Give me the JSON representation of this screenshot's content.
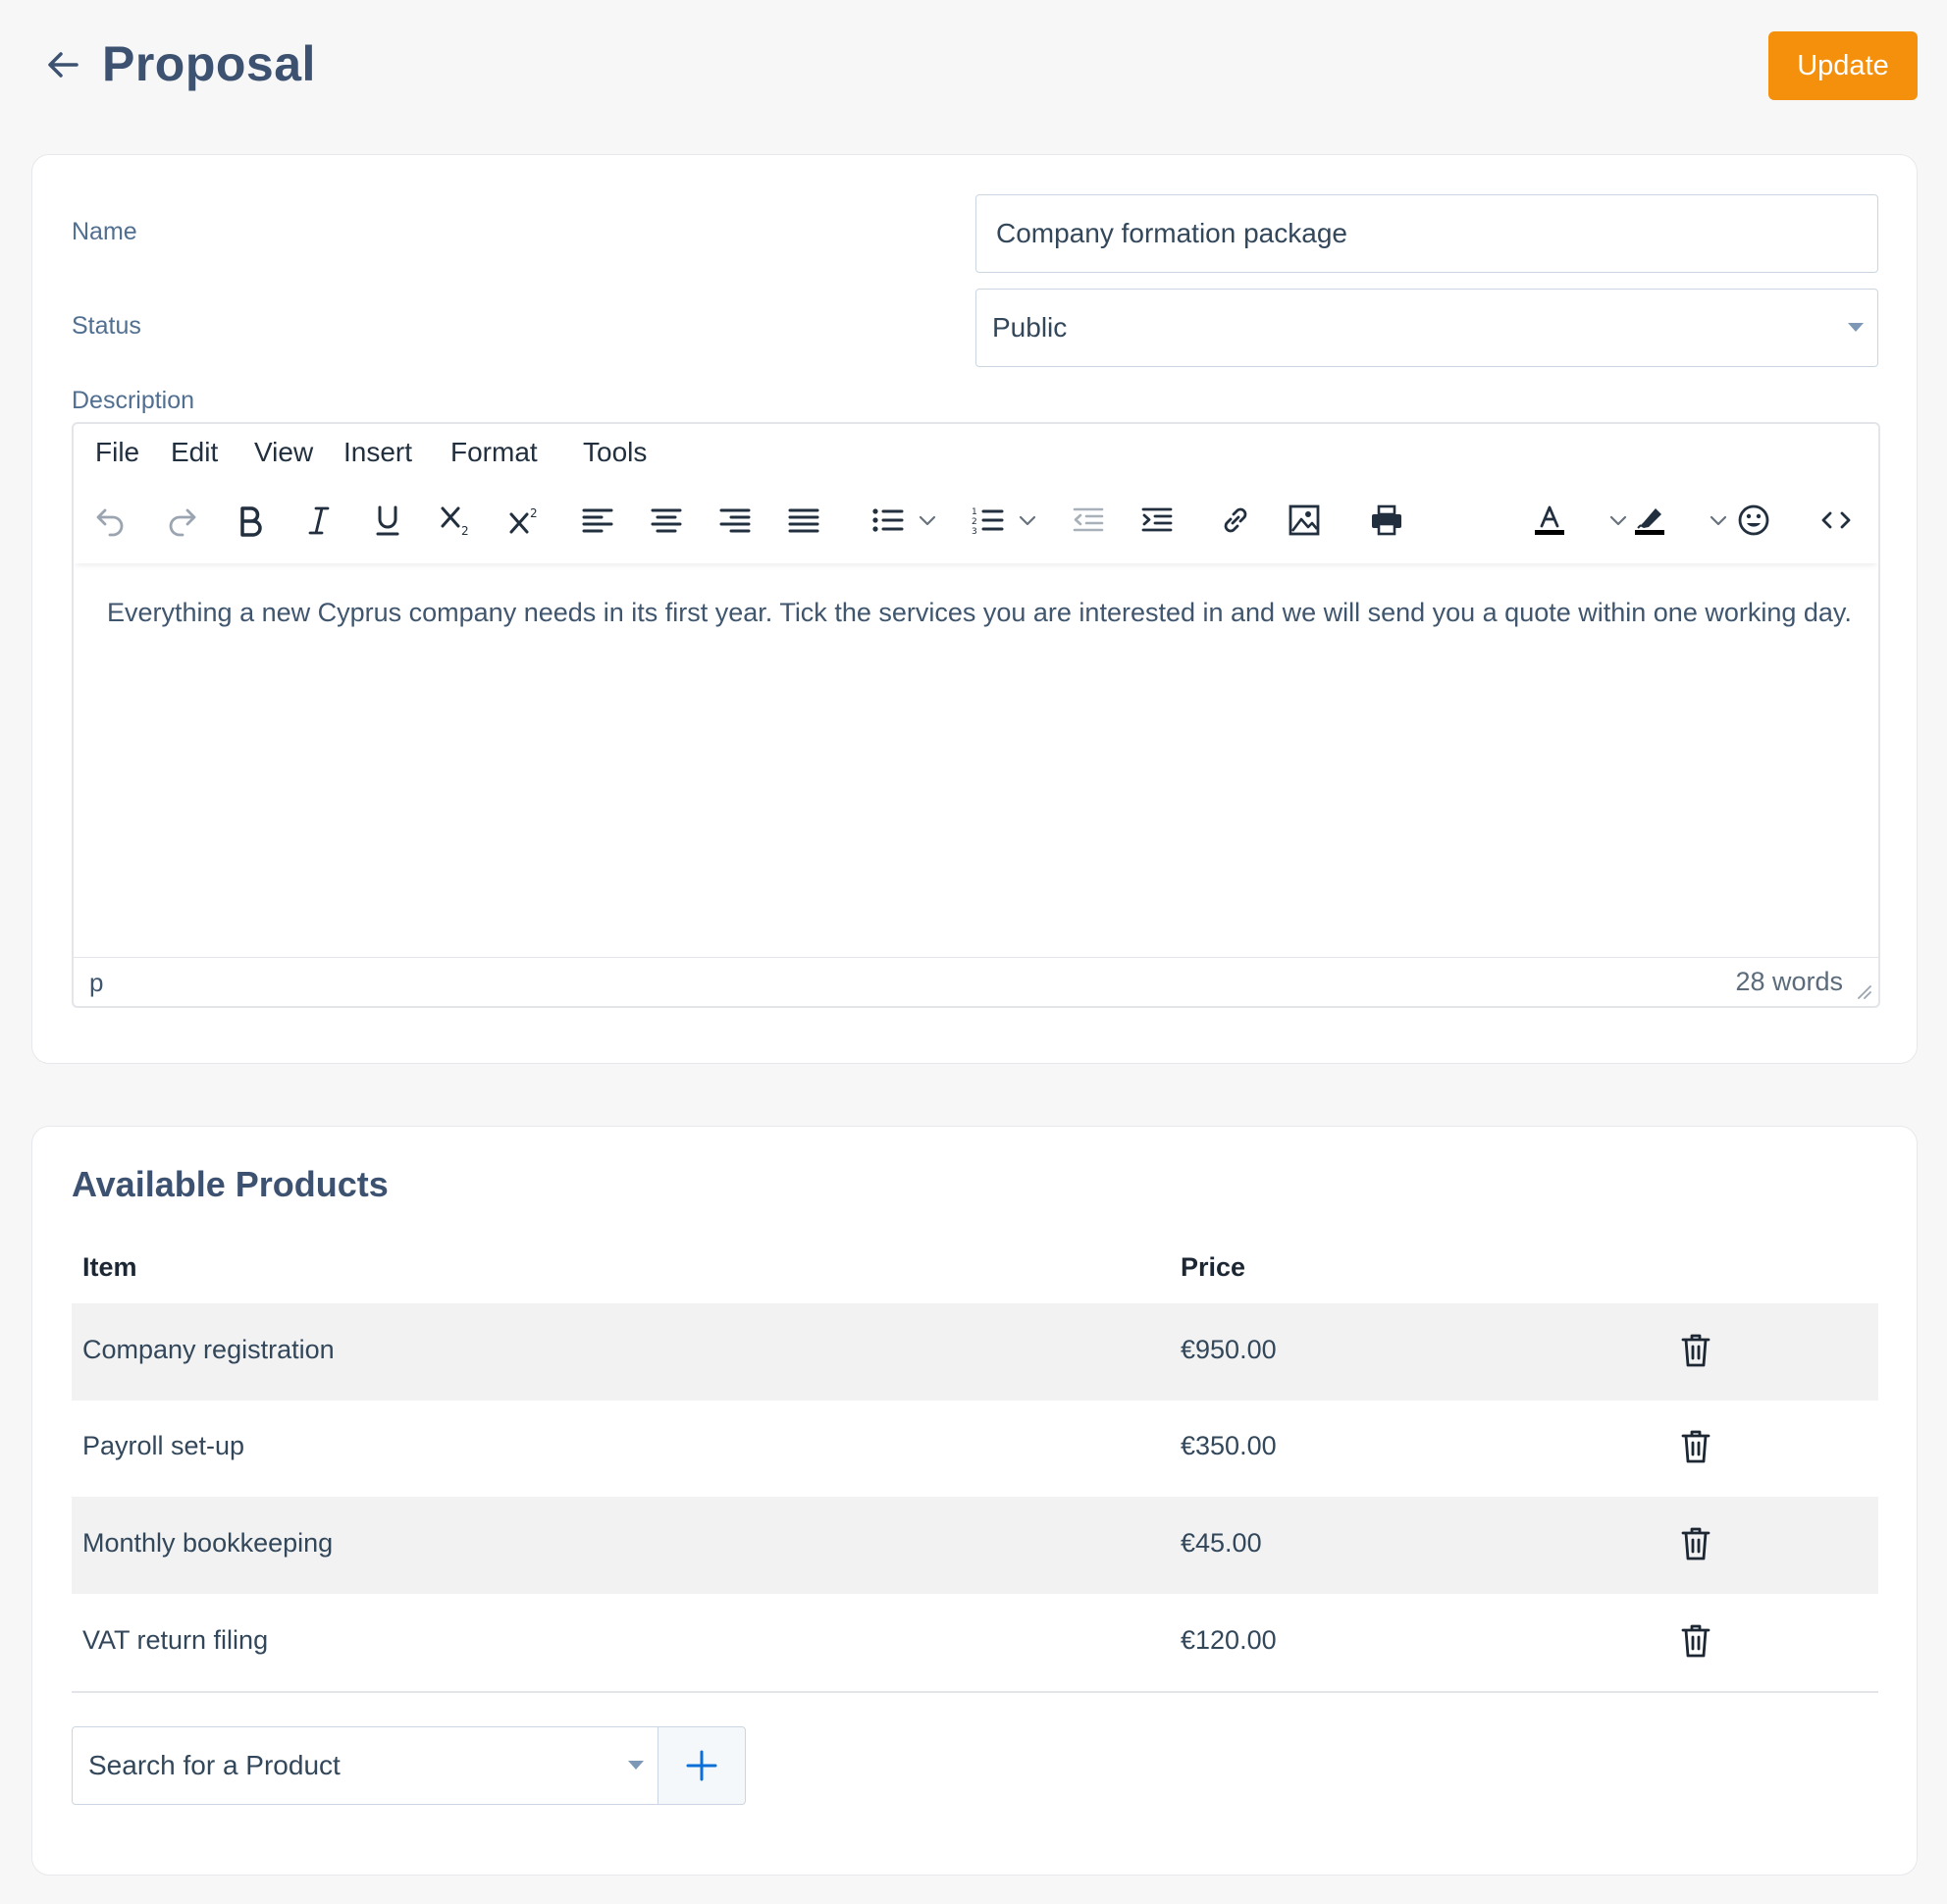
{
  "header": {
    "title": "Proposal",
    "update_label": "Update"
  },
  "form": {
    "name_label": "Name",
    "name_value": "Company formation package",
    "status_label": "Status",
    "status_value": "Public",
    "description_label": "Description"
  },
  "editor": {
    "menu": [
      "File",
      "Edit",
      "View",
      "Insert",
      "Format",
      "Tools"
    ],
    "toolbar_icons": [
      "undo-icon",
      "redo-icon",
      "bold-icon",
      "italic-icon",
      "underline-icon",
      "subscript-icon",
      "superscript-icon",
      "align-left-icon",
      "align-center-icon",
      "align-right-icon",
      "justify-icon",
      "bullet-list-icon",
      "numbered-list-icon",
      "outdent-icon",
      "indent-icon",
      "link-icon",
      "image-icon",
      "print-icon",
      "text-color-icon",
      "highlight-icon",
      "emoji-icon",
      "source-code-icon"
    ],
    "content": "Everything a new Cyprus company needs in its first year. Tick the services you are interested in and we will send you a quote within one working day.",
    "path": "p",
    "word_count": "28 words"
  },
  "products": {
    "title": "Available Products",
    "col_item": "Item",
    "col_price": "Price",
    "rows": [
      {
        "item": "Company registration",
        "price": "€950.00"
      },
      {
        "item": "Payroll set-up",
        "price": "€350.00"
      },
      {
        "item": "Monthly bookkeeping",
        "price": "€45.00"
      },
      {
        "item": "VAT return filing",
        "price": "€120.00"
      }
    ],
    "search_placeholder": "Search for a Product"
  },
  "colors": {
    "accent": "#f5900c",
    "heading": "#3d5270",
    "plus": "#0b6fd8"
  }
}
